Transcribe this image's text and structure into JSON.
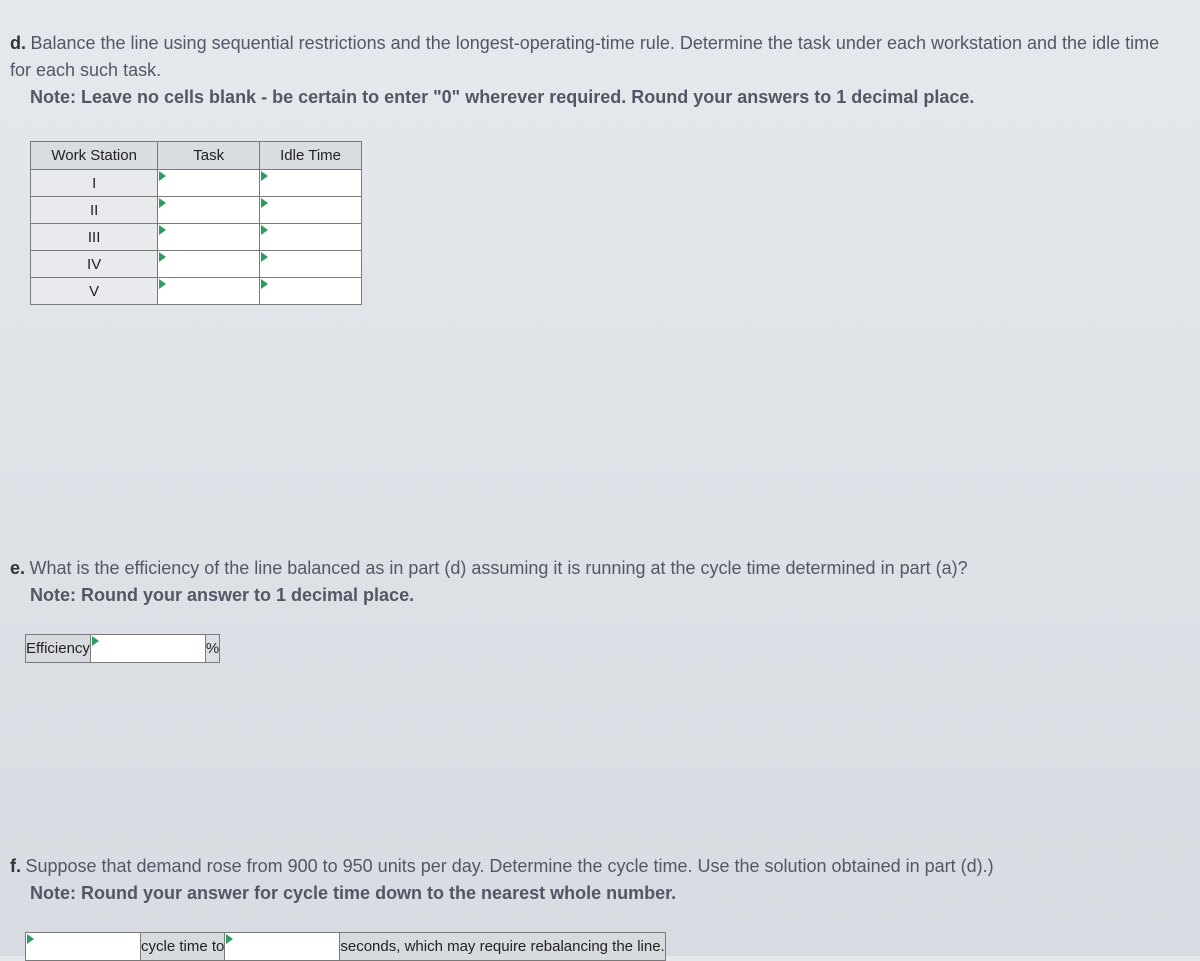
{
  "q_d": {
    "label": "d.",
    "text": " Balance the line using sequential restrictions and the longest-operating-time rule. Determine the task under each workstation and the idle time for each such task.",
    "note": "Note: Leave no cells blank - be certain to enter \"0\" wherever required. Round your answers to 1 decimal place."
  },
  "ws_table": {
    "headers": [
      "Work Station",
      "Task",
      "Idle Time"
    ],
    "rows": [
      "I",
      "II",
      "III",
      "IV",
      "V"
    ]
  },
  "q_e": {
    "label": "e.",
    "text": " What is the efficiency of the line balanced as in part (d) assuming it is running at the cycle time determined in part (a)?",
    "note": "Note: Round your answer to 1 decimal place."
  },
  "eff_table": {
    "label": "Efficiency",
    "unit": "%"
  },
  "q_f": {
    "label": "f.",
    "text": " Suppose that demand rose from 900 to 950 units per day. Determine the cycle time. Use the solution obtained in part (d).)",
    "note": "Note: Round your answer for cycle time down to the nearest whole number."
  },
  "cycle_table": {
    "mid_label": "cycle time to",
    "tail_label": "seconds, which may require rebalancing the line."
  }
}
